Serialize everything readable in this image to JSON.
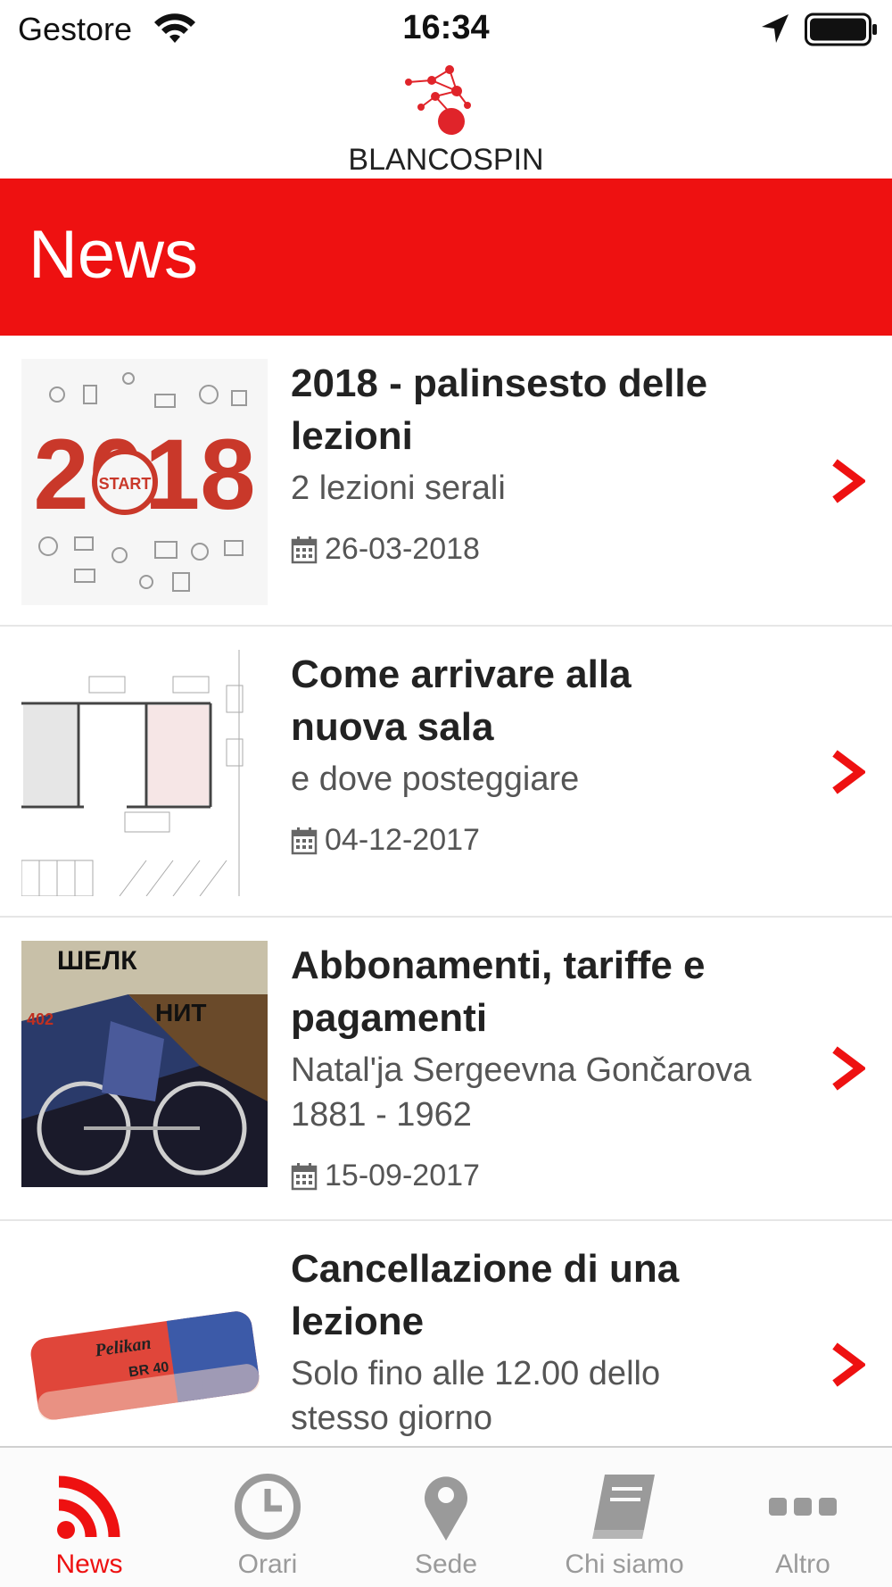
{
  "status_bar": {
    "carrier": "Gestore",
    "time": "16:34",
    "icons": [
      "wifi-icon",
      "location-arrow-icon",
      "battery-icon"
    ]
  },
  "logo": {
    "text": "BLANCOSPIN"
  },
  "header": {
    "title": "News"
  },
  "news": [
    {
      "title": "2018 - palinsesto delle lezioni",
      "subtitle": "2 lezioni serali",
      "date": "26-03-2018",
      "thumb_text": "2018",
      "thumb_badge": "START"
    },
    {
      "title": "Come arrivare alla nuova sala",
      "subtitle": "e dove posteggiare",
      "date": "04-12-2017"
    },
    {
      "title": "Abbonamenti, tariffe e pagamenti",
      "subtitle": "Natal'ja Sergeevna Gončarova 1881 - 1962",
      "date": "15-09-2017",
      "thumb_text": "ШЕЛК",
      "thumb_text2": "НИТ",
      "thumb_text3": "402"
    },
    {
      "title": "Cancellazione di una lezione",
      "subtitle": "Solo fino alle 12.00 dello stesso giorno",
      "thumb_brand": "Pelikan",
      "thumb_model": "BR 40"
    }
  ],
  "tabs": [
    {
      "label": "News",
      "icon": "rss-icon",
      "active": true
    },
    {
      "label": "Orari",
      "icon": "clock-icon",
      "active": false
    },
    {
      "label": "Sede",
      "icon": "map-pin-icon",
      "active": false
    },
    {
      "label": "Chi siamo",
      "icon": "book-icon",
      "active": false
    },
    {
      "label": "Altro",
      "icon": "more-icon",
      "active": false
    }
  ],
  "colors": {
    "accent": "#ee1111",
    "tab_inactive": "#9a9a9a",
    "text": "#333333"
  }
}
